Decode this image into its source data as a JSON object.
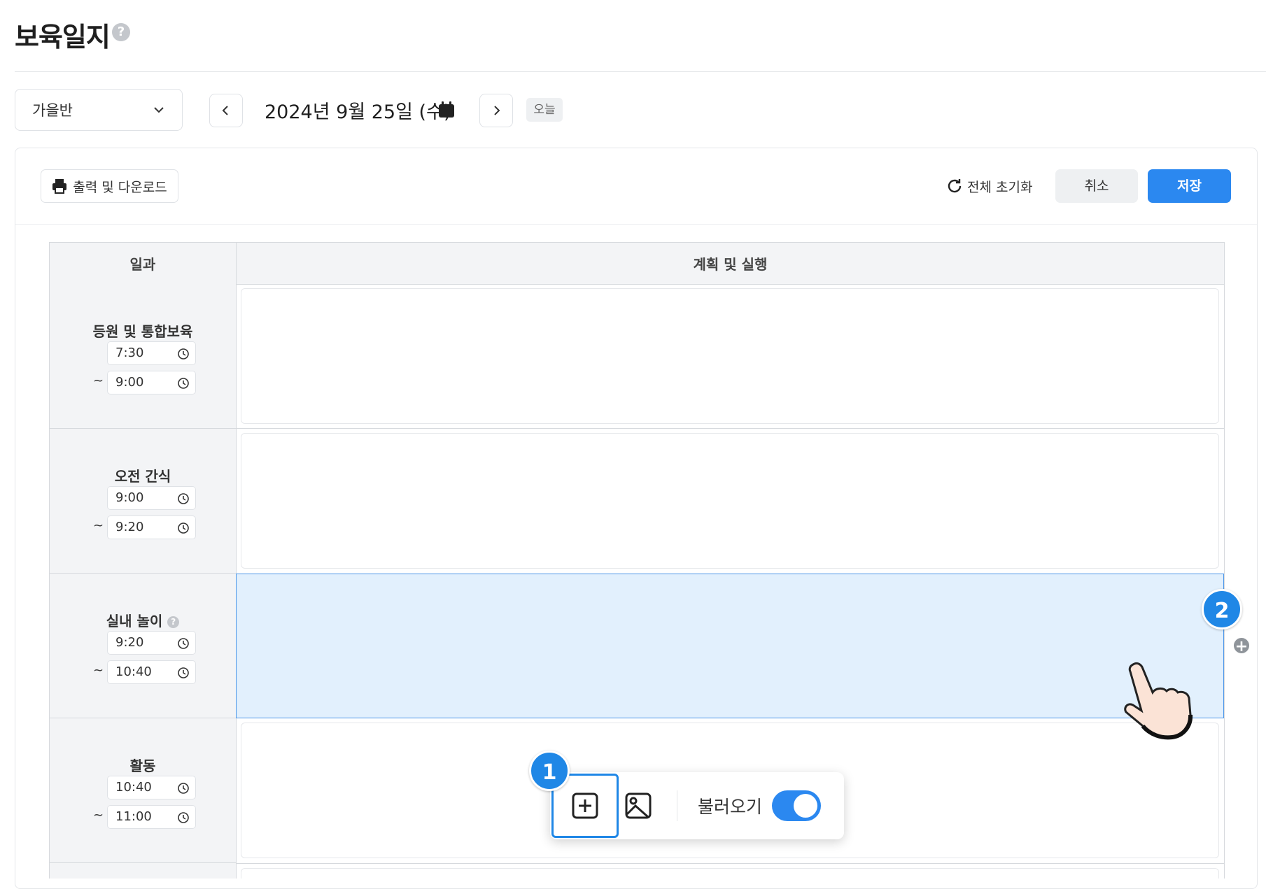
{
  "page": {
    "title": "보육일지",
    "help_icon": "?"
  },
  "controls": {
    "class_select_value": "가을반",
    "date": "2024년 9월 25일 (수)",
    "today_label": "오늘"
  },
  "actions": {
    "print_label": "출력 및 다운로드",
    "reset_label": "전체 초기화",
    "cancel_label": "취소",
    "save_label": "저장"
  },
  "table": {
    "headers": {
      "schedule": "일과",
      "plan": "계획 및 실행"
    },
    "rows": [
      {
        "title": "등원 및 통합보육",
        "start": "7:30",
        "end": "9:00",
        "tilde": "~"
      },
      {
        "title": "오전 간식",
        "start": "9:00",
        "end": "9:20",
        "tilde": "~"
      },
      {
        "title": "실내 놀이",
        "start": "9:20",
        "end": "10:40",
        "tilde": "~",
        "has_help": true
      },
      {
        "title": "활동",
        "start": "10:40",
        "end": "11:00",
        "tilde": "~"
      }
    ]
  },
  "popup": {
    "load_label": "불러오기",
    "load_toggle_on": true
  },
  "callouts": {
    "one": "1",
    "two": "2"
  },
  "colors": {
    "accent": "#2b88f0",
    "highlight": "#e2f0fd",
    "badge": "#1f87e6"
  }
}
